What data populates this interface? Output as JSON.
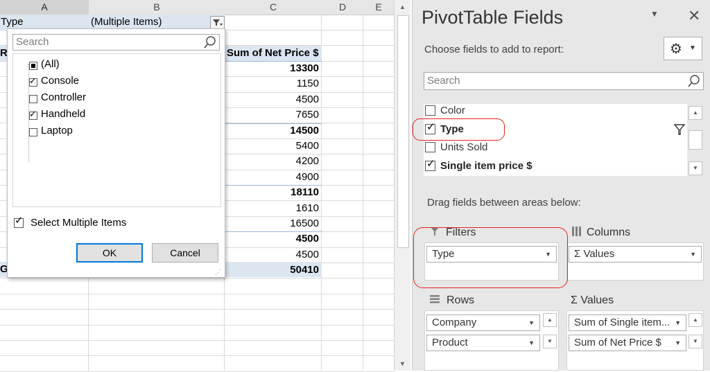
{
  "sheet": {
    "columns": [
      "A",
      "B",
      "C",
      "D",
      "E"
    ],
    "filter_row": {
      "field": "Type",
      "value": "(Multiple Items)"
    },
    "value_header": "Sum of Net Price $",
    "row_label_fragment": "Ro",
    "grand_label_fragment": "G",
    "values": [
      {
        "v": "13300",
        "bold": true
      },
      {
        "v": "1150",
        "bold": false
      },
      {
        "v": "4500",
        "bold": false
      },
      {
        "v": "7650",
        "bold": false
      },
      {
        "v": "14500",
        "bold": true
      },
      {
        "v": "5400",
        "bold": false
      },
      {
        "v": "4200",
        "bold": false
      },
      {
        "v": "4900",
        "bold": false
      },
      {
        "v": "18110",
        "bold": true
      },
      {
        "v": "1610",
        "bold": false
      },
      {
        "v": "16500",
        "bold": false
      },
      {
        "v": "4500",
        "bold": true
      },
      {
        "v": "4500",
        "bold": false
      },
      {
        "v": "50410",
        "bold": true
      }
    ]
  },
  "dropdown": {
    "search_placeholder": "Search",
    "items": [
      {
        "label": "(All)",
        "state": "partial"
      },
      {
        "label": "Console",
        "state": "checked"
      },
      {
        "label": "Controller",
        "state": "unchecked"
      },
      {
        "label": "Handheld",
        "state": "checked"
      },
      {
        "label": "Laptop",
        "state": "unchecked"
      }
    ],
    "select_multiple": {
      "label": "Select Multiple Items",
      "checked": true
    },
    "ok_label": "OK",
    "cancel_label": "Cancel"
  },
  "pane": {
    "title": "PivotTable Fields",
    "choose_text": "Choose fields to add to report:",
    "search_placeholder": "Search",
    "fields": [
      {
        "label": "Color",
        "checked": false
      },
      {
        "label": "Type",
        "checked": true
      },
      {
        "label": "Units Sold",
        "checked": false
      },
      {
        "label": "Single item price $",
        "checked": true
      }
    ],
    "drag_text": "Drag fields between areas below:",
    "areas": {
      "filters": {
        "label": "Filters",
        "items": [
          "Type"
        ]
      },
      "columns": {
        "label": "Columns",
        "items": [
          "Values"
        ]
      },
      "rows": {
        "label": "Rows",
        "items": [
          "Company",
          "Product"
        ]
      },
      "values": {
        "label": "Values",
        "items": [
          "Sum of Single item...",
          "Sum of Net Price $"
        ]
      }
    },
    "accent_color": "#e8201b"
  }
}
